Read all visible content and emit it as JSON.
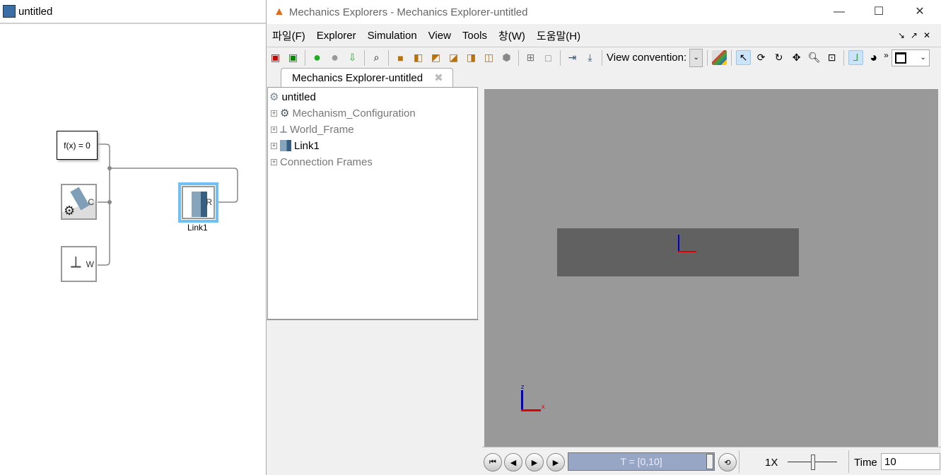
{
  "simulink": {
    "title": "untitled",
    "blocks": {
      "constraint": "f(x) = 0",
      "config_port": "C",
      "world_port": "W",
      "link_port": "R",
      "link_label": "Link1"
    }
  },
  "explorer": {
    "title": "Mechanics Explorers - Mechanics Explorer-untitled",
    "menu": [
      "파일(F)",
      "Explorer",
      "Simulation",
      "View",
      "Tools",
      "창(W)",
      "도움말(H)"
    ],
    "toolbar": {
      "view_convention_label": "View convention:",
      "overflow": "»"
    },
    "tab_label": "Mechanics Explorer-untitled",
    "tree": {
      "root": "untitled",
      "items": [
        {
          "label": "Mechanism_Configuration",
          "expand": "+"
        },
        {
          "label": "World_Frame",
          "expand": "+"
        },
        {
          "label": "Link1",
          "expand": "+"
        },
        {
          "label": "Connection Frames",
          "expand": "+"
        }
      ]
    },
    "triad": {
      "z": "z",
      "x": "x"
    },
    "playback": {
      "time_range": "T = [0,10]",
      "speed": "1X",
      "time_label": "Time",
      "time_value": "10"
    }
  },
  "colors": {
    "view_bg": "#999999",
    "body": "#616161",
    "axis_x": "#e00000",
    "axis_z": "#0000cc",
    "progress": "#96a6c4"
  }
}
